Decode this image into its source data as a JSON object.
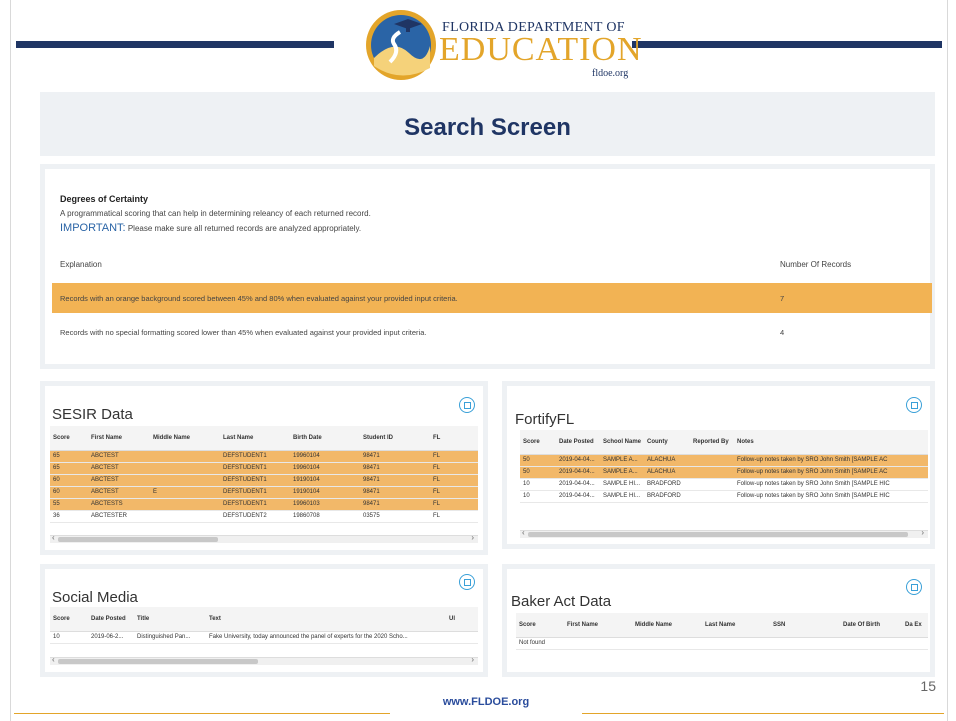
{
  "header": {
    "logo_line1": "FLORIDA DEPARTMENT OF",
    "logo_line2": "EDUCATION",
    "logo_line3": "fldoe.org",
    "title": "Search Screen"
  },
  "certainty": {
    "heading": "Degrees of Certainty",
    "description": "A programmatical scoring that can help in determining releancy of each returned record.",
    "important_label": "IMPORTANT:",
    "important_text": "Please make sure all returned records are analyzed appropriately.",
    "col_explanation": "Explanation",
    "col_records": "Number Of Records",
    "rows": [
      {
        "text": "Records with an orange background scored between 45% and 80% when evaluated against your provided input criteria.",
        "count": "7"
      },
      {
        "text": "Records with no special formatting scored lower than 45% when evaluated against your provided input criteria.",
        "count": "4"
      }
    ]
  },
  "sesir": {
    "title": "SESIR Data",
    "headers": [
      "Score",
      "First Name",
      "Middle Name",
      "Last Name",
      "Birth Date",
      "Student ID",
      "FL"
    ],
    "rows": [
      [
        "65",
        "ABCTEST",
        "",
        "DEFSTUDENT1",
        "19960104",
        "98471",
        "FL"
      ],
      [
        "65",
        "ABCTEST",
        "",
        "DEFSTUDENT1",
        "19960104",
        "98471",
        "FL"
      ],
      [
        "60",
        "ABCTEST",
        "",
        "DEFSTUDENT1",
        "19190104",
        "98471",
        "FL"
      ],
      [
        "60",
        "ABCTEST",
        "E",
        "DEFSTUDENT1",
        "19190104",
        "98471",
        "FL"
      ],
      [
        "55",
        "ABCTESTS",
        "",
        "DEFSTUDENT1",
        "19960103",
        "98471",
        "FL"
      ],
      [
        "36",
        "ABCTESTER",
        "",
        "DEFSTUDENT2",
        "19860708",
        "03575",
        "FL"
      ]
    ]
  },
  "fortify": {
    "title": "FortifyFL",
    "headers": [
      "Score",
      "Date Posted",
      "School Name",
      "County",
      "Reported By",
      "Notes"
    ],
    "rows": [
      [
        "50",
        "2019-04-04...",
        "SAMPLE A...",
        "ALACHUA",
        "",
        "Follow-up notes taken by SRO John Smith [SAMPLE AC"
      ],
      [
        "50",
        "2019-04-04...",
        "SAMPLE A...",
        "ALACHUA",
        "",
        "Follow-up notes taken by SRO John Smith [SAMPLE AC"
      ],
      [
        "10",
        "2019-04-04...",
        "SAMPLE HI...",
        "BRADFORD",
        "",
        "Follow-up notes taken by SRO John Smith [SAMPLE HIC"
      ],
      [
        "10",
        "2019-04-04...",
        "SAMPLE HI...",
        "BRADFORD",
        "",
        "Follow-up notes taken by SRO John Smith [SAMPLE HIC"
      ]
    ]
  },
  "social": {
    "title": "Social Media",
    "headers": [
      "Score",
      "Date Posted",
      "Title",
      "Text",
      "Ul"
    ],
    "rows": [
      [
        "10",
        "2019-06-2...",
        "Distinguished Pan...",
        "Fake University, today announced the panel of experts for the 2020 Scho...",
        ""
      ]
    ]
  },
  "baker": {
    "title": "Baker Act Data",
    "headers": [
      "Score",
      "First Name",
      "Middle Name",
      "Last Name",
      "SSN",
      "Date Of Birth",
      "Da Ex"
    ],
    "empty_text": "Not found"
  },
  "footer": {
    "url": "www.FLDOE.org",
    "page": "15"
  },
  "colors": {
    "navy": "#1f3564",
    "gold": "#e3a52a",
    "orange_row": "#f2b354",
    "icon_blue": "#3aa0d8"
  }
}
